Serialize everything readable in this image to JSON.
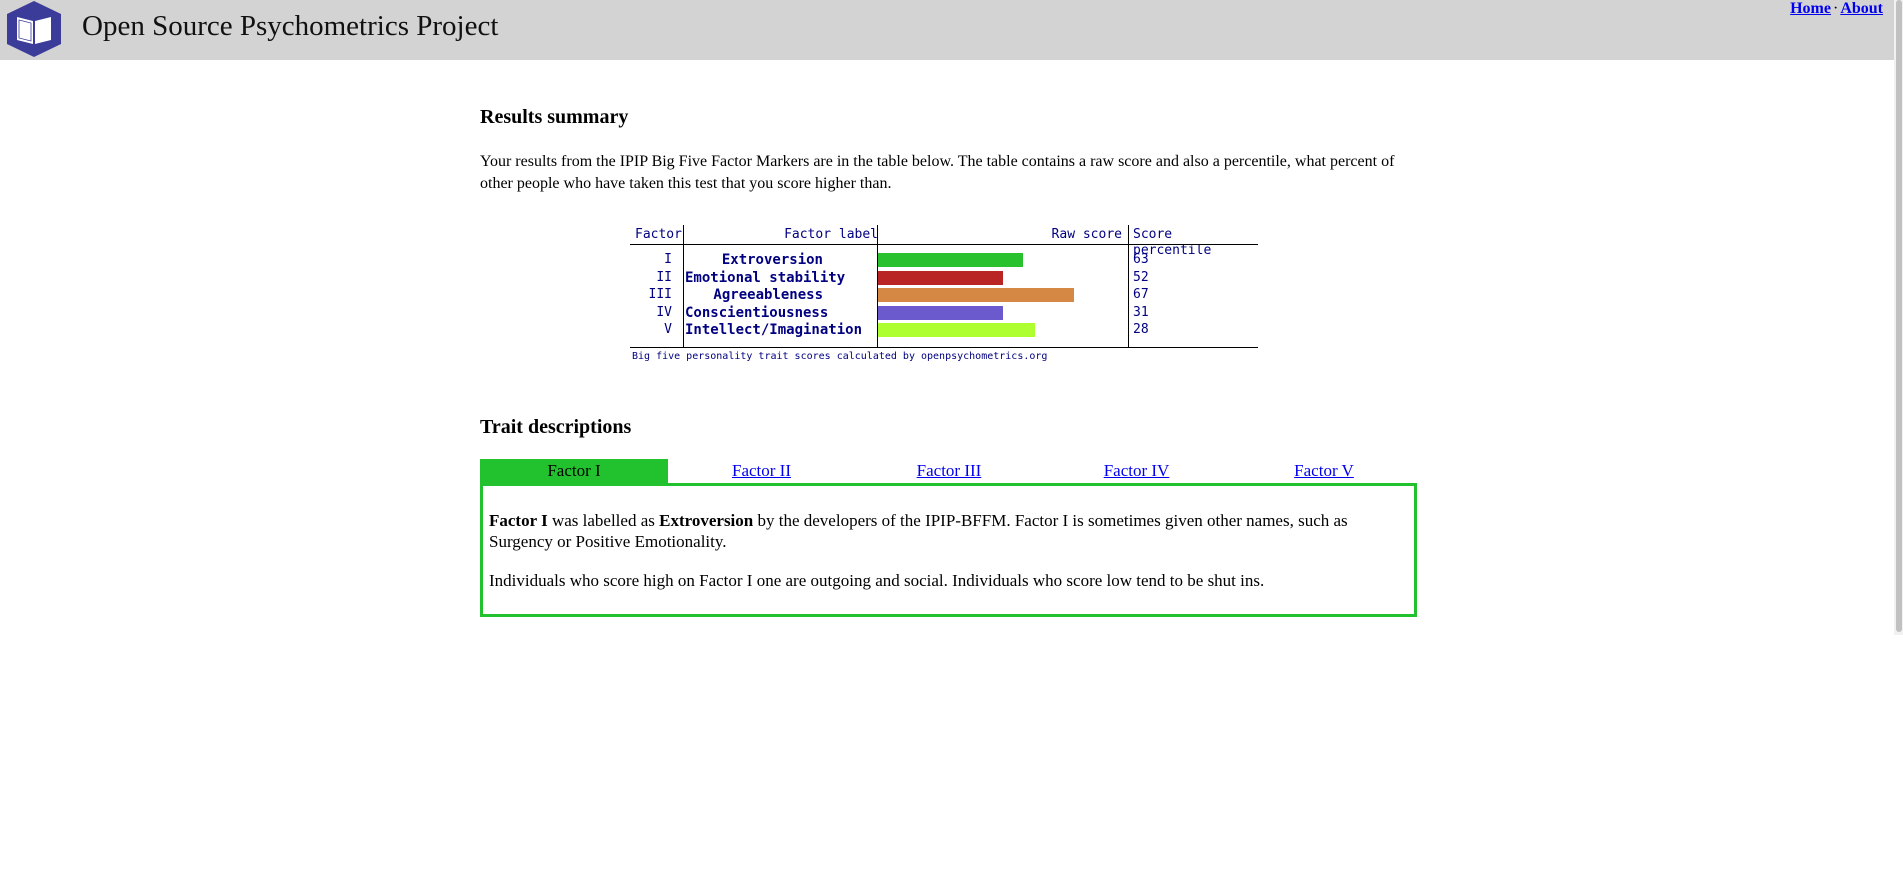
{
  "header": {
    "site_title": "Open Source Psychometrics Project",
    "nav": {
      "home": "Home",
      "separator": "·",
      "about": "About"
    },
    "logo_icon": "open-book-hexagon-icon",
    "logo_color": "#3b3b9a"
  },
  "results": {
    "heading": "Results summary",
    "intro": "Your results from the IPIP Big Five Factor Markers are in the table below. The table contains a raw score and also a percentile, what percent of other people who have taken this test that you score higher than."
  },
  "score_table": {
    "columns": {
      "factor": "Factor",
      "label": "Factor label",
      "raw": "Raw score",
      "percentile": "Score percentile"
    },
    "credit": "Big five personality trait scores calculated by openpsychometrics.org",
    "max_raw": 50,
    "rows": [
      {
        "factor": "I",
        "label": "Extroversion",
        "raw": 37,
        "percentile": "63",
        "color": "#2ac12e"
      },
      {
        "factor": "II",
        "label": "Emotional stability",
        "raw": 32,
        "percentile": "52",
        "color": "#b92525"
      },
      {
        "factor": "III",
        "label": "Agreeableness",
        "raw": 50,
        "percentile": "67",
        "color": "#d58843"
      },
      {
        "factor": "IV",
        "label": "Conscientiousness",
        "raw": 32,
        "percentile": "31",
        "color": "#6a5acd"
      },
      {
        "factor": "V",
        "label": "Intellect/Imagination",
        "raw": 40,
        "percentile": "28",
        "color": "#adff2f"
      }
    ]
  },
  "traits": {
    "heading": "Trait descriptions",
    "active_color": "#22c12e",
    "tabs": [
      "Factor I",
      "Factor II",
      "Factor III",
      "Factor IV",
      "Factor V"
    ],
    "active_tab": 0,
    "desc": {
      "p1_bold1": "Factor I",
      "p1_text1": " was labelled as ",
      "p1_bold2": "Extroversion",
      "p1_text2": " by the developers of the IPIP-BFFM. Factor I is sometimes given other names, such as Surgency or Positive Emotionality.",
      "p2": "Individuals who score high on Factor I one are outgoing and social. Individuals who score low tend to be shut ins."
    }
  }
}
